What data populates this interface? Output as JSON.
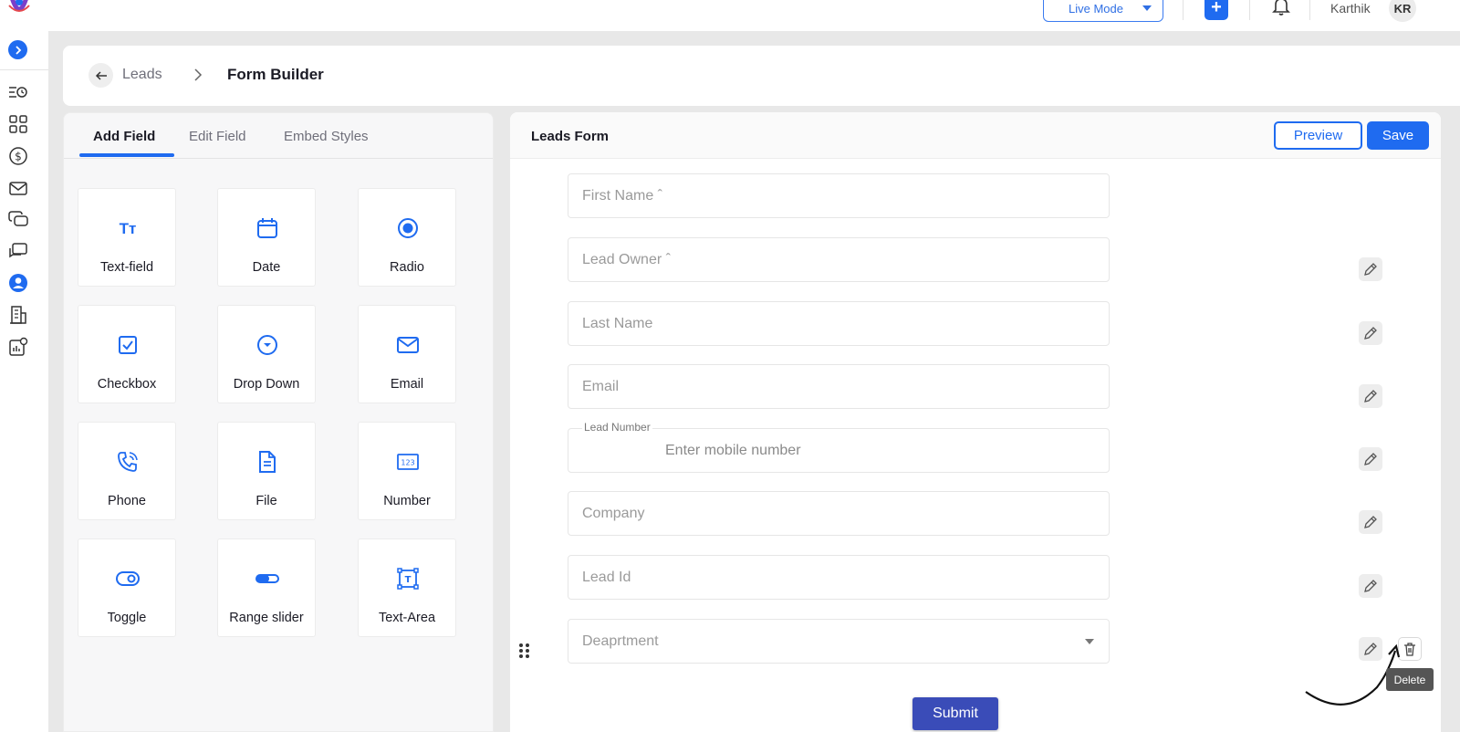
{
  "topbar": {
    "mode_label": "Live Mode",
    "add_label": "+",
    "user_name": "Karthik",
    "user_initials": "KR"
  },
  "sidebar": {
    "items": [
      "list-clock-icon",
      "grid-icon",
      "dollar-icon",
      "mail-icon",
      "chat-bubbles-icon",
      "messages-icon",
      "user-circle-icon",
      "building-icon",
      "analytics-settings-icon"
    ],
    "active_item": "user-circle-icon"
  },
  "breadcrumb": {
    "parent": "Leads",
    "current": "Form Builder"
  },
  "left_panel": {
    "tabs": [
      {
        "label": "Add Field",
        "active": true
      },
      {
        "label": "Edit Field",
        "active": false
      },
      {
        "label": "Embed Styles",
        "active": false
      }
    ],
    "fields": [
      {
        "label": "Text-field",
        "icon": "text-icon"
      },
      {
        "label": "Date",
        "icon": "calendar-icon"
      },
      {
        "label": "Radio",
        "icon": "radio-icon"
      },
      {
        "label": "Checkbox",
        "icon": "checkbox-icon"
      },
      {
        "label": "Drop Down",
        "icon": "dropdown-icon"
      },
      {
        "label": "Email",
        "icon": "email-icon"
      },
      {
        "label": "Phone",
        "icon": "phone-icon"
      },
      {
        "label": "File",
        "icon": "file-icon"
      },
      {
        "label": "Number",
        "icon": "number-icon"
      },
      {
        "label": "Toggle",
        "icon": "toggle-icon"
      },
      {
        "label": "Range slider",
        "icon": "range-slider-icon"
      },
      {
        "label": "Text-Area",
        "icon": "text-area-icon"
      }
    ]
  },
  "form": {
    "title": "Leads Form",
    "preview_label": "Preview",
    "save_label": "Save",
    "fields": [
      {
        "placeholder": "First Name ˆ"
      },
      {
        "placeholder": "Lead Owner ˆ"
      },
      {
        "placeholder": "Last Name"
      },
      {
        "placeholder": "Email"
      },
      {
        "label": "Lead Number",
        "placeholder": "Enter mobile number"
      },
      {
        "placeholder": "Company"
      },
      {
        "placeholder": "Lead Id"
      },
      {
        "placeholder": "Deaprtment",
        "type": "select"
      }
    ],
    "tooltip": "Delete",
    "submit_label": "Submit"
  },
  "colors": {
    "primary": "#1f6bf0",
    "submit": "#3a4cb8",
    "background": "#e8e8e8"
  }
}
